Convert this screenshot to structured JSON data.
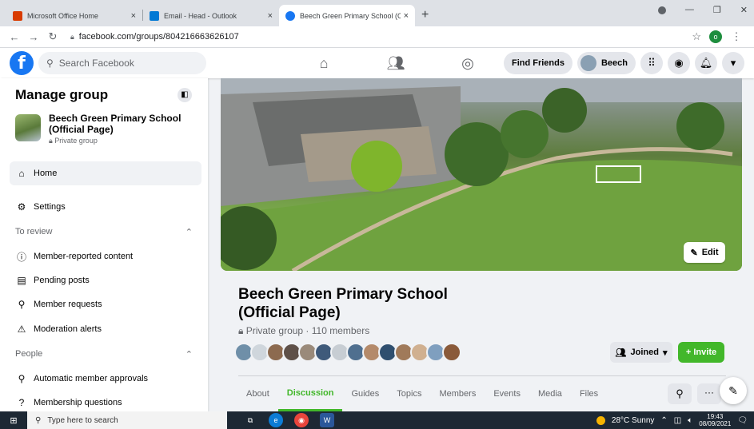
{
  "browser": {
    "tabs": [
      {
        "label": "Microsoft Office Home",
        "close": "×",
        "color": "#d83b01"
      },
      {
        "label": "Email - Head - Outlook",
        "close": "×",
        "color": "#0078d4"
      },
      {
        "label": "Beech Green Primary School (Offi",
        "close": "×",
        "color": "#1877f2"
      }
    ],
    "new_tab": "+",
    "url": "facebook.com/groups/804216663626107",
    "profile_initial": "o"
  },
  "fb": {
    "search_placeholder": "Search Facebook",
    "find_friends": "Find Friends",
    "user_name": "Beech"
  },
  "sidebar": {
    "title": "Manage group",
    "group_name": "Beech Green Primary School (Official Page)",
    "group_privacy": "Private group",
    "home": "Home",
    "settings": "Settings",
    "section_review": "To review",
    "review_items": [
      "Member-reported content",
      "Pending posts",
      "Member requests",
      "Moderation alerts"
    ],
    "section_people": "People",
    "people_items": [
      "Automatic member approvals",
      "Membership questions"
    ]
  },
  "group": {
    "edit_label": "Edit",
    "title": "Beech Green Primary School (Official Page)",
    "meta": "Private group · 110 members",
    "joined_label": "Joined",
    "invite_label": "+ Invite",
    "tabs": [
      "About",
      "Discussion",
      "Guides",
      "Topics",
      "Members",
      "Events",
      "Media",
      "Files"
    ],
    "active_tab": "Discussion",
    "more_label": "···",
    "avatar_colors": [
      "#6f8fa8",
      "#cfd6dc",
      "#8c6a4f",
      "#5e5048",
      "#9a8a7a",
      "#3f5a7a",
      "#c7cdd3",
      "#4f6f8f",
      "#b48a6a",
      "#2f4f6f",
      "#a07a5a",
      "#d0b090",
      "#7f9fbf",
      "#8a5a3a"
    ]
  },
  "taskbar": {
    "search_placeholder": "Type here to search",
    "weather": "28°C  Sunny",
    "time": "19:43",
    "date": "08/09/2021"
  }
}
